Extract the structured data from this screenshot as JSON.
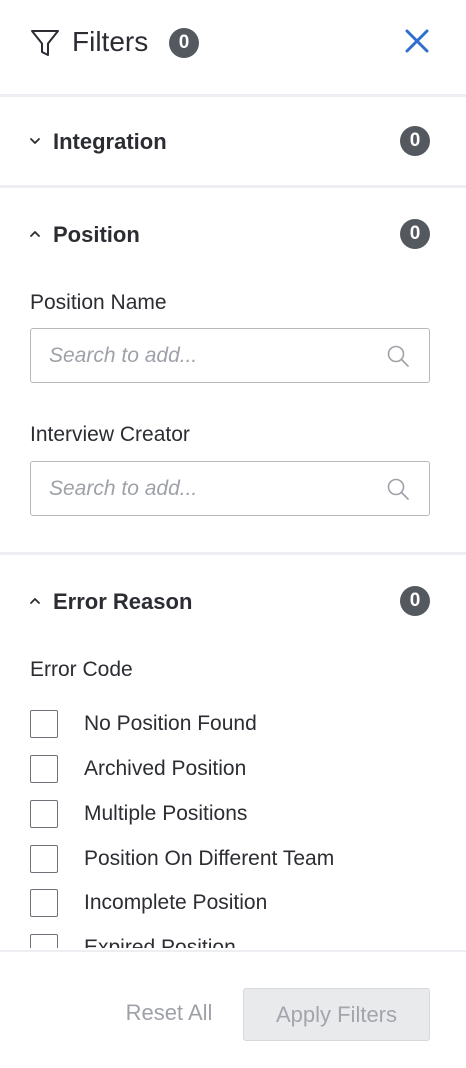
{
  "header": {
    "title": "Filters",
    "count": "0",
    "icons": {
      "filter": "funnel-icon",
      "close": "close-icon"
    },
    "close_color": "#2f6fd0"
  },
  "sections": {
    "integration": {
      "label": "Integration",
      "count": "0",
      "expanded": false
    },
    "position": {
      "label": "Position",
      "count": "0",
      "expanded": true,
      "fields": [
        {
          "label": "Position Name",
          "placeholder": "Search to add...",
          "value": ""
        },
        {
          "label": "Interview Creator",
          "placeholder": "Search to add...",
          "value": ""
        }
      ]
    },
    "error_reason": {
      "label": "Error Reason",
      "count": "0",
      "expanded": true,
      "group_label": "Error Code",
      "options": [
        {
          "label": "No Position Found",
          "checked": false
        },
        {
          "label": "Archived Position",
          "checked": false
        },
        {
          "label": "Multiple Positions",
          "checked": false
        },
        {
          "label": "Position On Different Team",
          "checked": false
        },
        {
          "label": "Incomplete Position",
          "checked": false
        },
        {
          "label": "Expired Position",
          "checked": false
        }
      ]
    }
  },
  "footer": {
    "reset_label": "Reset All",
    "apply_label": "Apply Filters"
  }
}
